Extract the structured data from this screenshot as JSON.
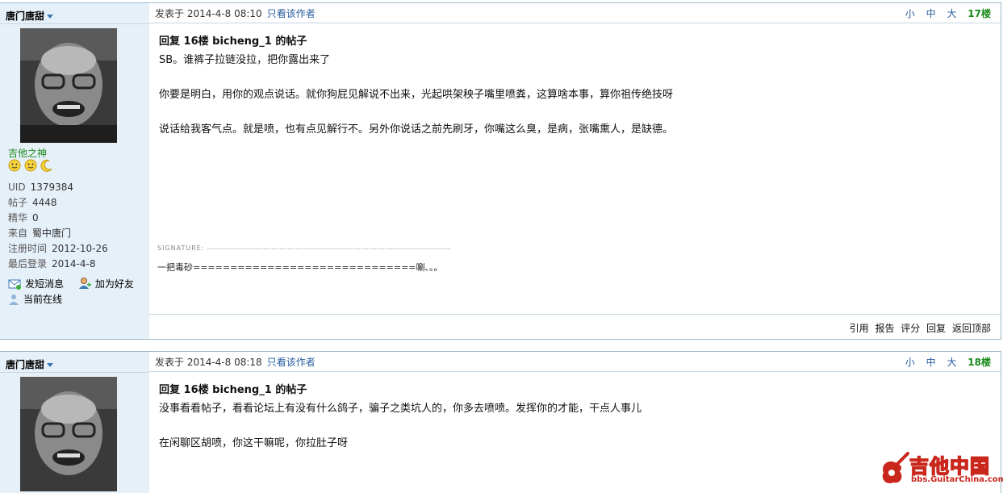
{
  "posts": [
    {
      "author": "唐门唐甜",
      "rank": "吉他之神",
      "info": [
        {
          "k": "UID",
          "v": "1379384"
        },
        {
          "k": "帖子",
          "v": "4448"
        },
        {
          "k": "精华",
          "v": "0"
        },
        {
          "k": "来自",
          "v": "蜀中唐门"
        },
        {
          "k": "注册时间",
          "v": "2012-10-26"
        },
        {
          "k": "最后登录",
          "v": "2014-4-8"
        }
      ],
      "actions": {
        "pm": "发短消息",
        "friend": "加为好友",
        "online": "当前在线"
      },
      "meta": {
        "posted": "发表于 2014-4-8 08:10",
        "only_author": "只看该作者",
        "small": "小",
        "medium": "中",
        "large": "大",
        "floor": "17楼"
      },
      "title": "回复 16楼 bicheng_1 的帖子",
      "paragraphs": [
        "SB。谁裤子拉链没拉，把你露出来了",
        "你要是明白，用你的观点说话。就你狗屁见解说不出来，光起哄架秧子嘴里喷粪，这算啥本事，算你祖传绝技呀",
        "说话给我客气点。就是喷，也有点见解行不。另外你说话之前先刷牙，你嘴这么臭，是病，张嘴熏人，是缺德。"
      ],
      "signature_label": "SIGNATURE:",
      "signature": "一把毒砂==============================唰、。。",
      "footer": {
        "quote": "引用",
        "report": "报告",
        "rate": "评分",
        "reply": "回复",
        "top": "返回顶部"
      }
    },
    {
      "author": "唐门唐甜",
      "meta": {
        "posted": "发表于 2014-4-8 08:18",
        "only_author": "只看该作者",
        "small": "小",
        "medium": "中",
        "large": "大",
        "floor": "18楼"
      },
      "title": "回复 16楼 bicheng_1 的帖子",
      "paragraphs": [
        "没事看看帖子，看看论坛上有没有什么鸽子，骗子之类坑人的，你多去喷喷。发挥你的才能，干点人事儿",
        "在闲聊区胡喷，你这干嘛呢，你拉肚子呀"
      ]
    }
  ],
  "logo": {
    "name": "吉他中国",
    "url": "bbs.GuitarChina.com"
  },
  "colors": {
    "sidebar": "#e6f0f8",
    "link": "#2a5d9f",
    "green": "#1a8a1a",
    "border": "#9cb8c8",
    "logo_red": "#c9261c"
  }
}
